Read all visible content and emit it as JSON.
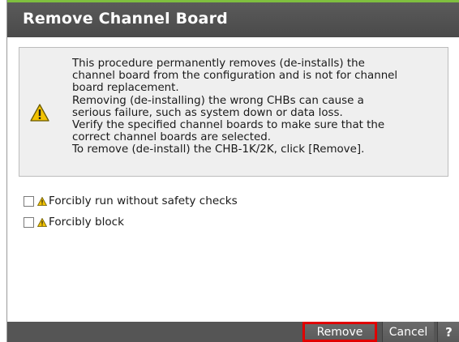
{
  "dialog": {
    "title": "Remove Channel Board"
  },
  "warning": {
    "icon": "warning-triangle-icon",
    "lines": [
      "This procedure permanently removes (de-installs) the",
      "channel board from the configuration and is not for channel",
      "board replacement.",
      "Removing (de-installing) the wrong CHBs can cause a",
      "serious failure, such as system down or data loss.",
      "Verify the specified channel boards to make sure that the",
      "correct channel boards are selected.",
      "To remove (de-install) the CHB-1K/2K, click [Remove]."
    ]
  },
  "options": [
    {
      "label": "Forcibly run without safety checks",
      "checked": false
    },
    {
      "label": "Forcibly block",
      "checked": false
    }
  ],
  "footer": {
    "remove_label": "Remove",
    "cancel_label": "Cancel",
    "help_label": "?"
  },
  "colors": {
    "title_bar": "#4a4a4a",
    "accent_line": "#7fbf3f",
    "highlight": "#e00000",
    "warning_yellow": "#f2c200"
  }
}
